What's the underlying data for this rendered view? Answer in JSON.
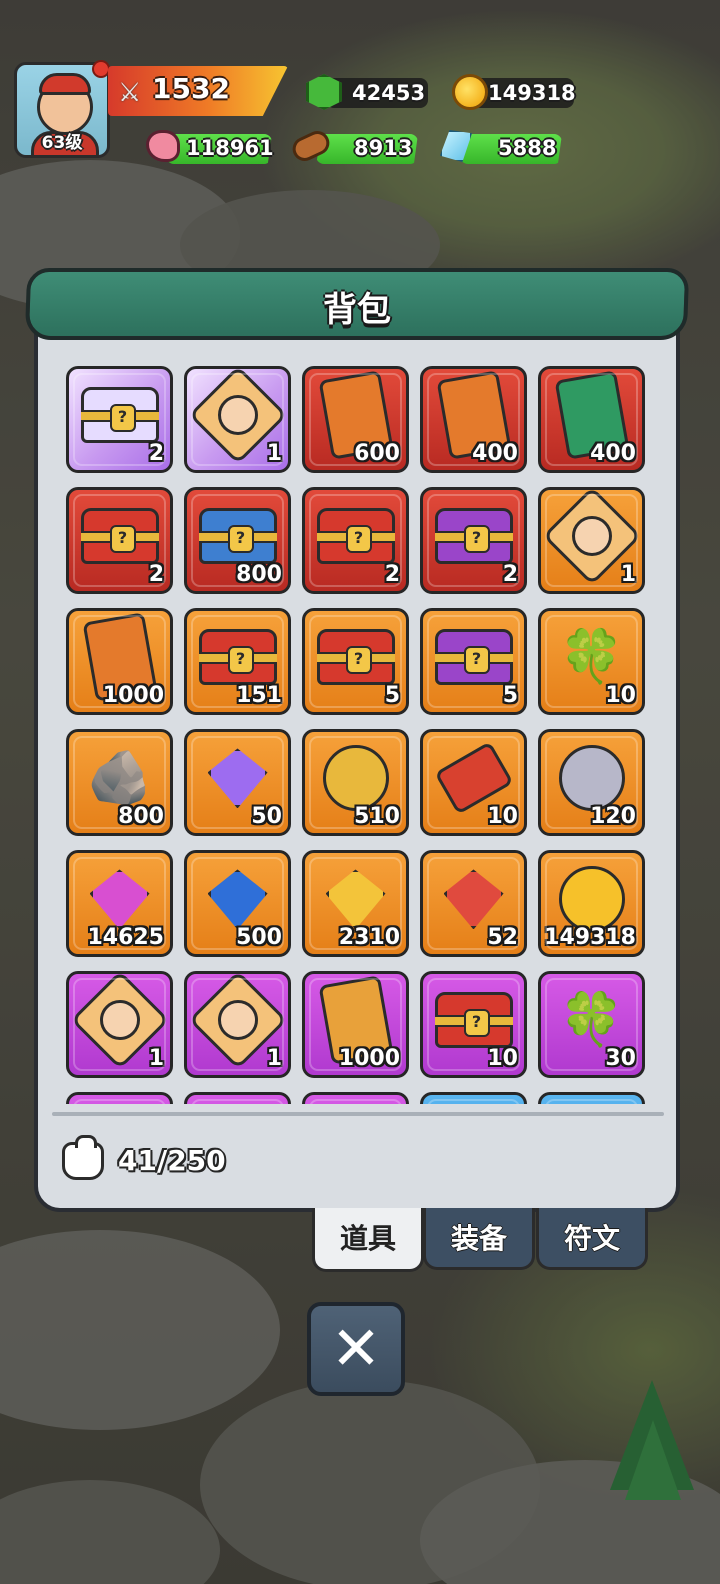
{
  "player": {
    "level_label": "63级",
    "power": "1532"
  },
  "resources": {
    "gem": "42453",
    "gold": "149318",
    "meat": "118961",
    "wood": "8913",
    "crystal": "5888"
  },
  "bag": {
    "title": "背包",
    "capacity": "41/250",
    "items": [
      {
        "rarity": "purple",
        "icon": "heart-chest",
        "count": "2"
      },
      {
        "rarity": "purple",
        "icon": "hero-portrait-elder",
        "count": "1"
      },
      {
        "rarity": "red",
        "icon": "crown-card",
        "count": "600"
      },
      {
        "rarity": "red",
        "icon": "cloud-card",
        "count": "400"
      },
      {
        "rarity": "red",
        "icon": "three-kingdoms-card",
        "count": "400"
      },
      {
        "rarity": "red",
        "icon": "mystery-chest",
        "count": "2"
      },
      {
        "rarity": "red",
        "icon": "crown-chest",
        "count": "800"
      },
      {
        "rarity": "red",
        "icon": "mystery-chest-small",
        "count": "2"
      },
      {
        "rarity": "red",
        "icon": "cat-chest",
        "count": "2"
      },
      {
        "rarity": "orange",
        "icon": "hero-portrait-warrior",
        "count": "1"
      },
      {
        "rarity": "orange",
        "icon": "crown-card",
        "count": "1000"
      },
      {
        "rarity": "orange",
        "icon": "diamond-chest",
        "count": "151"
      },
      {
        "rarity": "orange",
        "icon": "mystery-chest-small",
        "count": "5"
      },
      {
        "rarity": "orange",
        "icon": "cat-mystery-chest",
        "count": "5"
      },
      {
        "rarity": "orange",
        "icon": "clover",
        "count": "10"
      },
      {
        "rarity": "orange",
        "icon": "stone",
        "count": "800"
      },
      {
        "rarity": "orange",
        "icon": "purple-crystal",
        "count": "50"
      },
      {
        "rarity": "orange",
        "icon": "star-badge",
        "count": "510"
      },
      {
        "rarity": "orange",
        "icon": "ticket",
        "count": "10"
      },
      {
        "rarity": "orange",
        "icon": "rune-stone",
        "count": "120"
      },
      {
        "rarity": "orange",
        "icon": "pink-diamond",
        "count": "14625"
      },
      {
        "rarity": "orange",
        "icon": "blue-gem",
        "count": "500"
      },
      {
        "rarity": "orange",
        "icon": "gold-gem",
        "count": "2310"
      },
      {
        "rarity": "orange",
        "icon": "red-gem",
        "count": "52"
      },
      {
        "rarity": "orange",
        "icon": "gold-coin",
        "count": "149318"
      },
      {
        "rarity": "violet",
        "icon": "hero-portrait-nurse",
        "count": "1"
      },
      {
        "rarity": "violet",
        "icon": "hero-portrait-witch",
        "count": "1"
      },
      {
        "rarity": "violet",
        "icon": "mystery-card",
        "count": "1000"
      },
      {
        "rarity": "violet",
        "icon": "mystery-chest-small",
        "count": "10"
      },
      {
        "rarity": "violet",
        "icon": "gold-clover",
        "count": "30"
      },
      {
        "rarity": "violet",
        "icon": "unknown",
        "count": ""
      },
      {
        "rarity": "violet",
        "icon": "unknown",
        "count": ""
      },
      {
        "rarity": "violet",
        "icon": "unknown",
        "count": ""
      },
      {
        "rarity": "blue",
        "icon": "unknown",
        "count": ""
      },
      {
        "rarity": "blue",
        "icon": "unknown",
        "count": ""
      }
    ]
  },
  "tabs": [
    {
      "label": "道具",
      "active": true
    },
    {
      "label": "装备",
      "active": false
    },
    {
      "label": "符文",
      "active": false
    }
  ]
}
